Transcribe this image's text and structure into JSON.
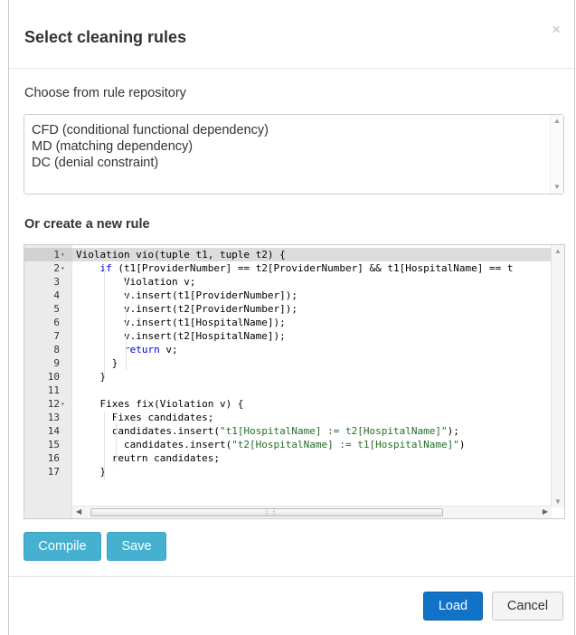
{
  "dialog": {
    "title": "Select cleaning rules",
    "close_glyph": "×"
  },
  "repository": {
    "label": "Choose from rule repository",
    "items": [
      "CFD (conditional functional dependency)",
      "MD (matching dependency)",
      "DC (denial constraint)"
    ]
  },
  "new_rule": {
    "label": "Or create a new rule"
  },
  "editor": {
    "lines": [
      {
        "n": "1",
        "text": "Violation vio(tuple t1, tuple t2) {"
      },
      {
        "n": "2",
        "text": "    if (t1[ProviderNumber] == t2[ProviderNumber] && t1[HospitalName] == t"
      },
      {
        "n": "3",
        "text": "        Violation v;"
      },
      {
        "n": "4",
        "text": "        v.insert(t1[ProviderNumber]);"
      },
      {
        "n": "5",
        "text": "        v.insert(t2[ProviderNumber]);"
      },
      {
        "n": "6",
        "text": "        v.insert(t1[HospitalName]);"
      },
      {
        "n": "7",
        "text": "        v.insert(t2[HospitalName]);"
      },
      {
        "n": "8",
        "text": "        return v;"
      },
      {
        "n": "9",
        "text": "      }"
      },
      {
        "n": "10",
        "text": "    }"
      },
      {
        "n": "11",
        "text": ""
      },
      {
        "n": "12",
        "text": "    Fixes fix(Violation v) {"
      },
      {
        "n": "13",
        "text": "      Fixes candidates;"
      },
      {
        "n": "14",
        "text": "      candidates.insert(\"t1[HospitalName] := t2[HospitalName]\");"
      },
      {
        "n": "15",
        "text": "        candidates.insert(\"t2[HospitalName] := t1[HospitalName]\")"
      },
      {
        "n": "16",
        "text": "      reutrn candidates;"
      },
      {
        "n": "17",
        "text": "    }"
      }
    ],
    "keyword": "return",
    "foldable_lines": [
      1,
      2,
      12
    ]
  },
  "buttons": {
    "compile": "Compile",
    "save": "Save",
    "load": "Load",
    "cancel": "Cancel"
  },
  "colors": {
    "info": "#45b0cf",
    "primary": "#1173c7",
    "string": "#236e24",
    "keyword": "#0000cc"
  }
}
